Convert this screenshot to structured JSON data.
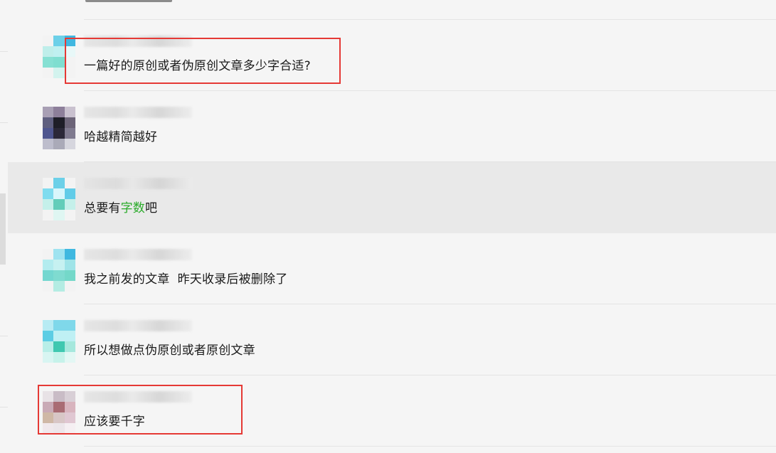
{
  "conversation": {
    "messages": [
      {
        "sender": "",
        "text": "一篇好的原创或者伪原创文章多少字合适?",
        "highlighted": false,
        "annotated": true,
        "avatar": [
          "#f3f3f3",
          "#6cd0e8",
          "#3fb7e0",
          "#bfeeea",
          "#bff0f0",
          "#e8f8f8",
          "#86e0d3",
          "#7fded0",
          "#f3f3f3",
          "#f3f3f3",
          "#d3f3ee",
          "#f3f3f3"
        ]
      },
      {
        "sender": "",
        "text": "哈越精简越好",
        "highlighted": false,
        "annotated": false,
        "avatar": [
          "#a89fb4",
          "#8d7f9a",
          "#c9c1cf",
          "#5f5f7f",
          "#1e1e28",
          "#6c6478",
          "#4f568f",
          "#2b2838",
          "#7f7a8f",
          "#bdbdcc",
          "#aaaab8",
          "#d6d6de"
        ]
      },
      {
        "sender": "",
        "text_before": "总要有",
        "text_highlight": "字数",
        "text_after": "吧",
        "highlighted": true,
        "annotated": false,
        "avatar": [
          "#f3f3f3",
          "#6cd0e8",
          "#f3f3f3",
          "#7fdcef",
          "#d9f6fb",
          "#62cce8",
          "#c5f0ea",
          "#62cdb9",
          "#c5f0ea",
          "#f3f3f3",
          "#dff6f2",
          "#f3f3f3"
        ]
      },
      {
        "sender": "",
        "text": "我之前发的文章  昨天收录后被删除了",
        "highlighted": false,
        "annotated": false,
        "avatar": [
          "#f3f3f3",
          "#9fe3f0",
          "#3fb8e0",
          "#b3ecef",
          "#c6f1f1",
          "#9fe4e8",
          "#74d7d0",
          "#7fdbd0",
          "#74d8c9",
          "#f3f3f3",
          "#b4ece3",
          "#f3f3f3"
        ]
      },
      {
        "sender": "",
        "text": "所以想做点伪原创或者原创文章",
        "highlighted": false,
        "annotated": false,
        "avatar": [
          "#b7ebf3",
          "#7fd8ea",
          "#7fd8ea",
          "#5ccde4",
          "#bff0f4",
          "#bff0f4",
          "#b8eee8",
          "#3fc8b0",
          "#a6e8dd",
          "#d8f5f2",
          "#c6f2ea",
          "#e3f7f4"
        ]
      },
      {
        "sender": "",
        "text": "应该要千字",
        "highlighted": false,
        "annotated": true,
        "avatar": [
          "#e8e2e6",
          "#c9bcc6",
          "#d8cfd6",
          "#c9aab6",
          "#a96c74",
          "#d8b4be",
          "#cfb8a6",
          "#d8c6c6",
          "#e0c7d2",
          "#f0e8ec",
          "#ece6ea",
          "#f5eff2"
        ]
      }
    ]
  },
  "colors": {
    "background": "#f5f5f5",
    "selected_row": "#e9e9e9",
    "annotation_box": "#e53935",
    "keyword_highlight": "#2bab2b"
  }
}
